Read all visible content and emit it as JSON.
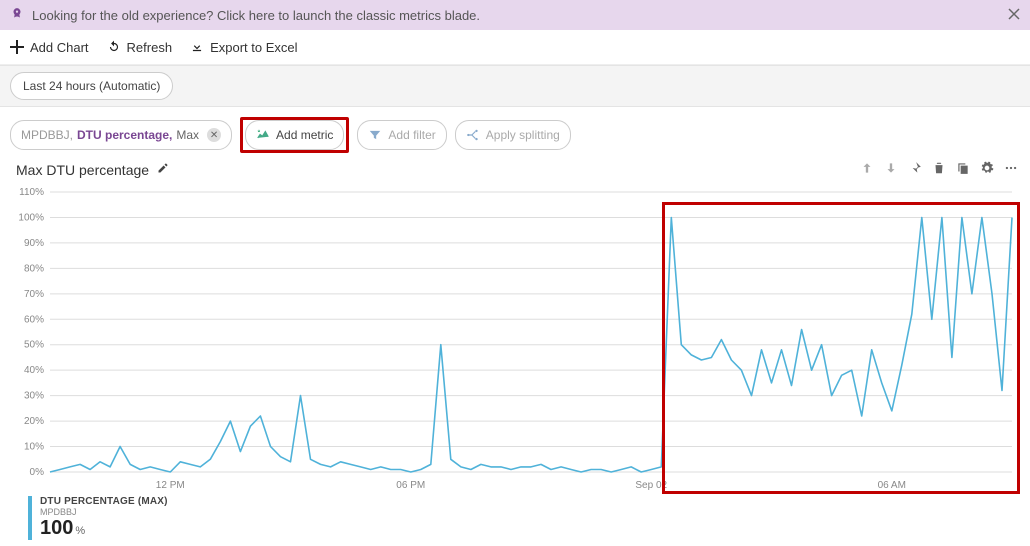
{
  "banner": {
    "text": "Looking for the old experience? Click here to launch the classic metrics blade."
  },
  "toolbar": {
    "add_chart": "Add Chart",
    "refresh": "Refresh",
    "export": "Export to Excel"
  },
  "time_range_chip": "Last 24 hours (Automatic)",
  "metric_pill": {
    "db": "MPDBBJ,",
    "metric": "DTU percentage,",
    "agg": "Max"
  },
  "add_metric_label": "Add metric",
  "add_filter_label": "Add filter",
  "apply_splitting_label": "Apply splitting",
  "title": "Max DTU percentage",
  "legend": {
    "line1": "DTU PERCENTAGE (MAX)",
    "line2": "MPDBBJ",
    "value": "100",
    "unit": "%"
  },
  "chart_data": {
    "type": "line",
    "title": "Max DTU percentage",
    "ylabel": "",
    "xlabel": "",
    "ylim": [
      0,
      110
    ],
    "y_ticks": [
      "0%",
      "10%",
      "20%",
      "30%",
      "40%",
      "50%",
      "60%",
      "70%",
      "80%",
      "90%",
      "100%",
      "110%"
    ],
    "x_ticks": [
      {
        "pos": 0.125,
        "label": "12 PM"
      },
      {
        "pos": 0.375,
        "label": "06 PM"
      },
      {
        "pos": 0.625,
        "label": "Sep 02"
      },
      {
        "pos": 0.875,
        "label": "06 AM"
      }
    ],
    "series": [
      {
        "name": "DTU percentage (Max) – MPDBBJ",
        "color": "#4fb2d9",
        "values": [
          0,
          1,
          2,
          3,
          1,
          4,
          2,
          10,
          3,
          1,
          2,
          1,
          0,
          4,
          3,
          2,
          5,
          12,
          20,
          8,
          18,
          22,
          10,
          6,
          4,
          30,
          5,
          3,
          2,
          4,
          3,
          2,
          1,
          2,
          1,
          1,
          0,
          1,
          3,
          50,
          5,
          2,
          1,
          3,
          2,
          2,
          1,
          2,
          2,
          3,
          1,
          2,
          1,
          0,
          1,
          1,
          0,
          1,
          2,
          0,
          1,
          2,
          100,
          50,
          46,
          44,
          45,
          52,
          44,
          40,
          30,
          48,
          35,
          48,
          34,
          56,
          40,
          50,
          30,
          38,
          40,
          22,
          48,
          35,
          24,
          42,
          62,
          100,
          60,
          100,
          45,
          100,
          70,
          100,
          70,
          32,
          100
        ]
      }
    ],
    "highlight_range_x": [
      0.64,
      1.0
    ]
  }
}
